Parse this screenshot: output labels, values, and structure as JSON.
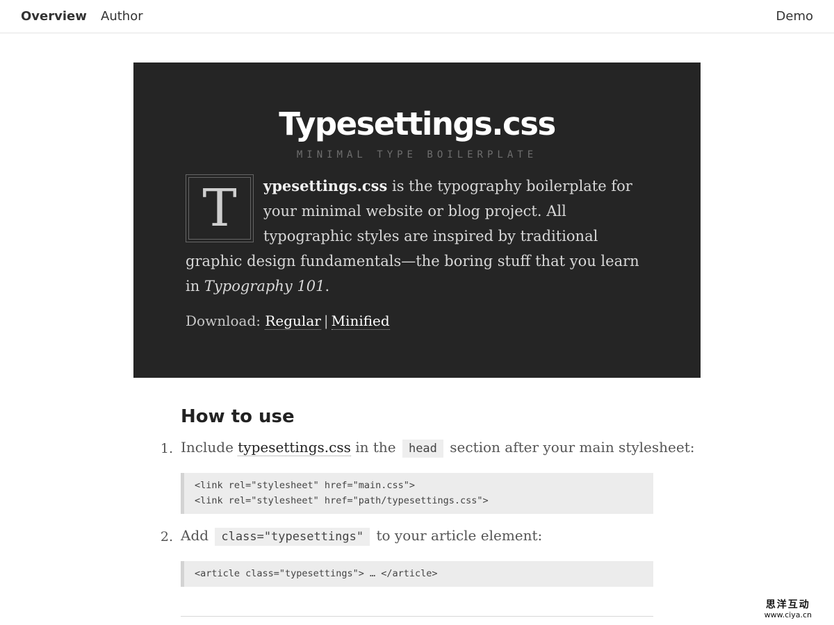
{
  "nav": {
    "overview": "Overview",
    "author": "Author",
    "demo": "Demo"
  },
  "hero": {
    "title": "Typesettings.css",
    "subtitle": "MINIMAL TYPE BOILERPLATE",
    "dropcap": "T",
    "intro_bold": "ypesettings.css",
    "intro_text": " is the typography boilerplate for your minimal website or blog project. All typographic styles are inspired by traditional graphic design fundamentals—the boring stuff that you learn in ",
    "intro_italic": "Typography 101",
    "intro_end": ".",
    "download_label": "Download:",
    "download_regular": "Regular",
    "download_separator": "|",
    "download_minified": "Minified"
  },
  "howto": {
    "heading": "How to use",
    "step1": {
      "number": "1.",
      "text_before": "Include ",
      "link": "typesettings.css",
      "text_mid": " in the ",
      "code": "head",
      "text_after": " section after your main stylesheet:",
      "codeblock": "<link rel=\"stylesheet\" href=\"main.css\">\n<link rel=\"stylesheet\" href=\"path/typesettings.css\">"
    },
    "step2": {
      "number": "2.",
      "text_before": "Add ",
      "code": "class=\"typesettings\"",
      "text_after": " to your article element:",
      "codeblock": "<article class=\"typesettings\"> … </article>"
    }
  },
  "watermark": {
    "chinese": "思洋互动",
    "url": "www.ciya.cn"
  }
}
